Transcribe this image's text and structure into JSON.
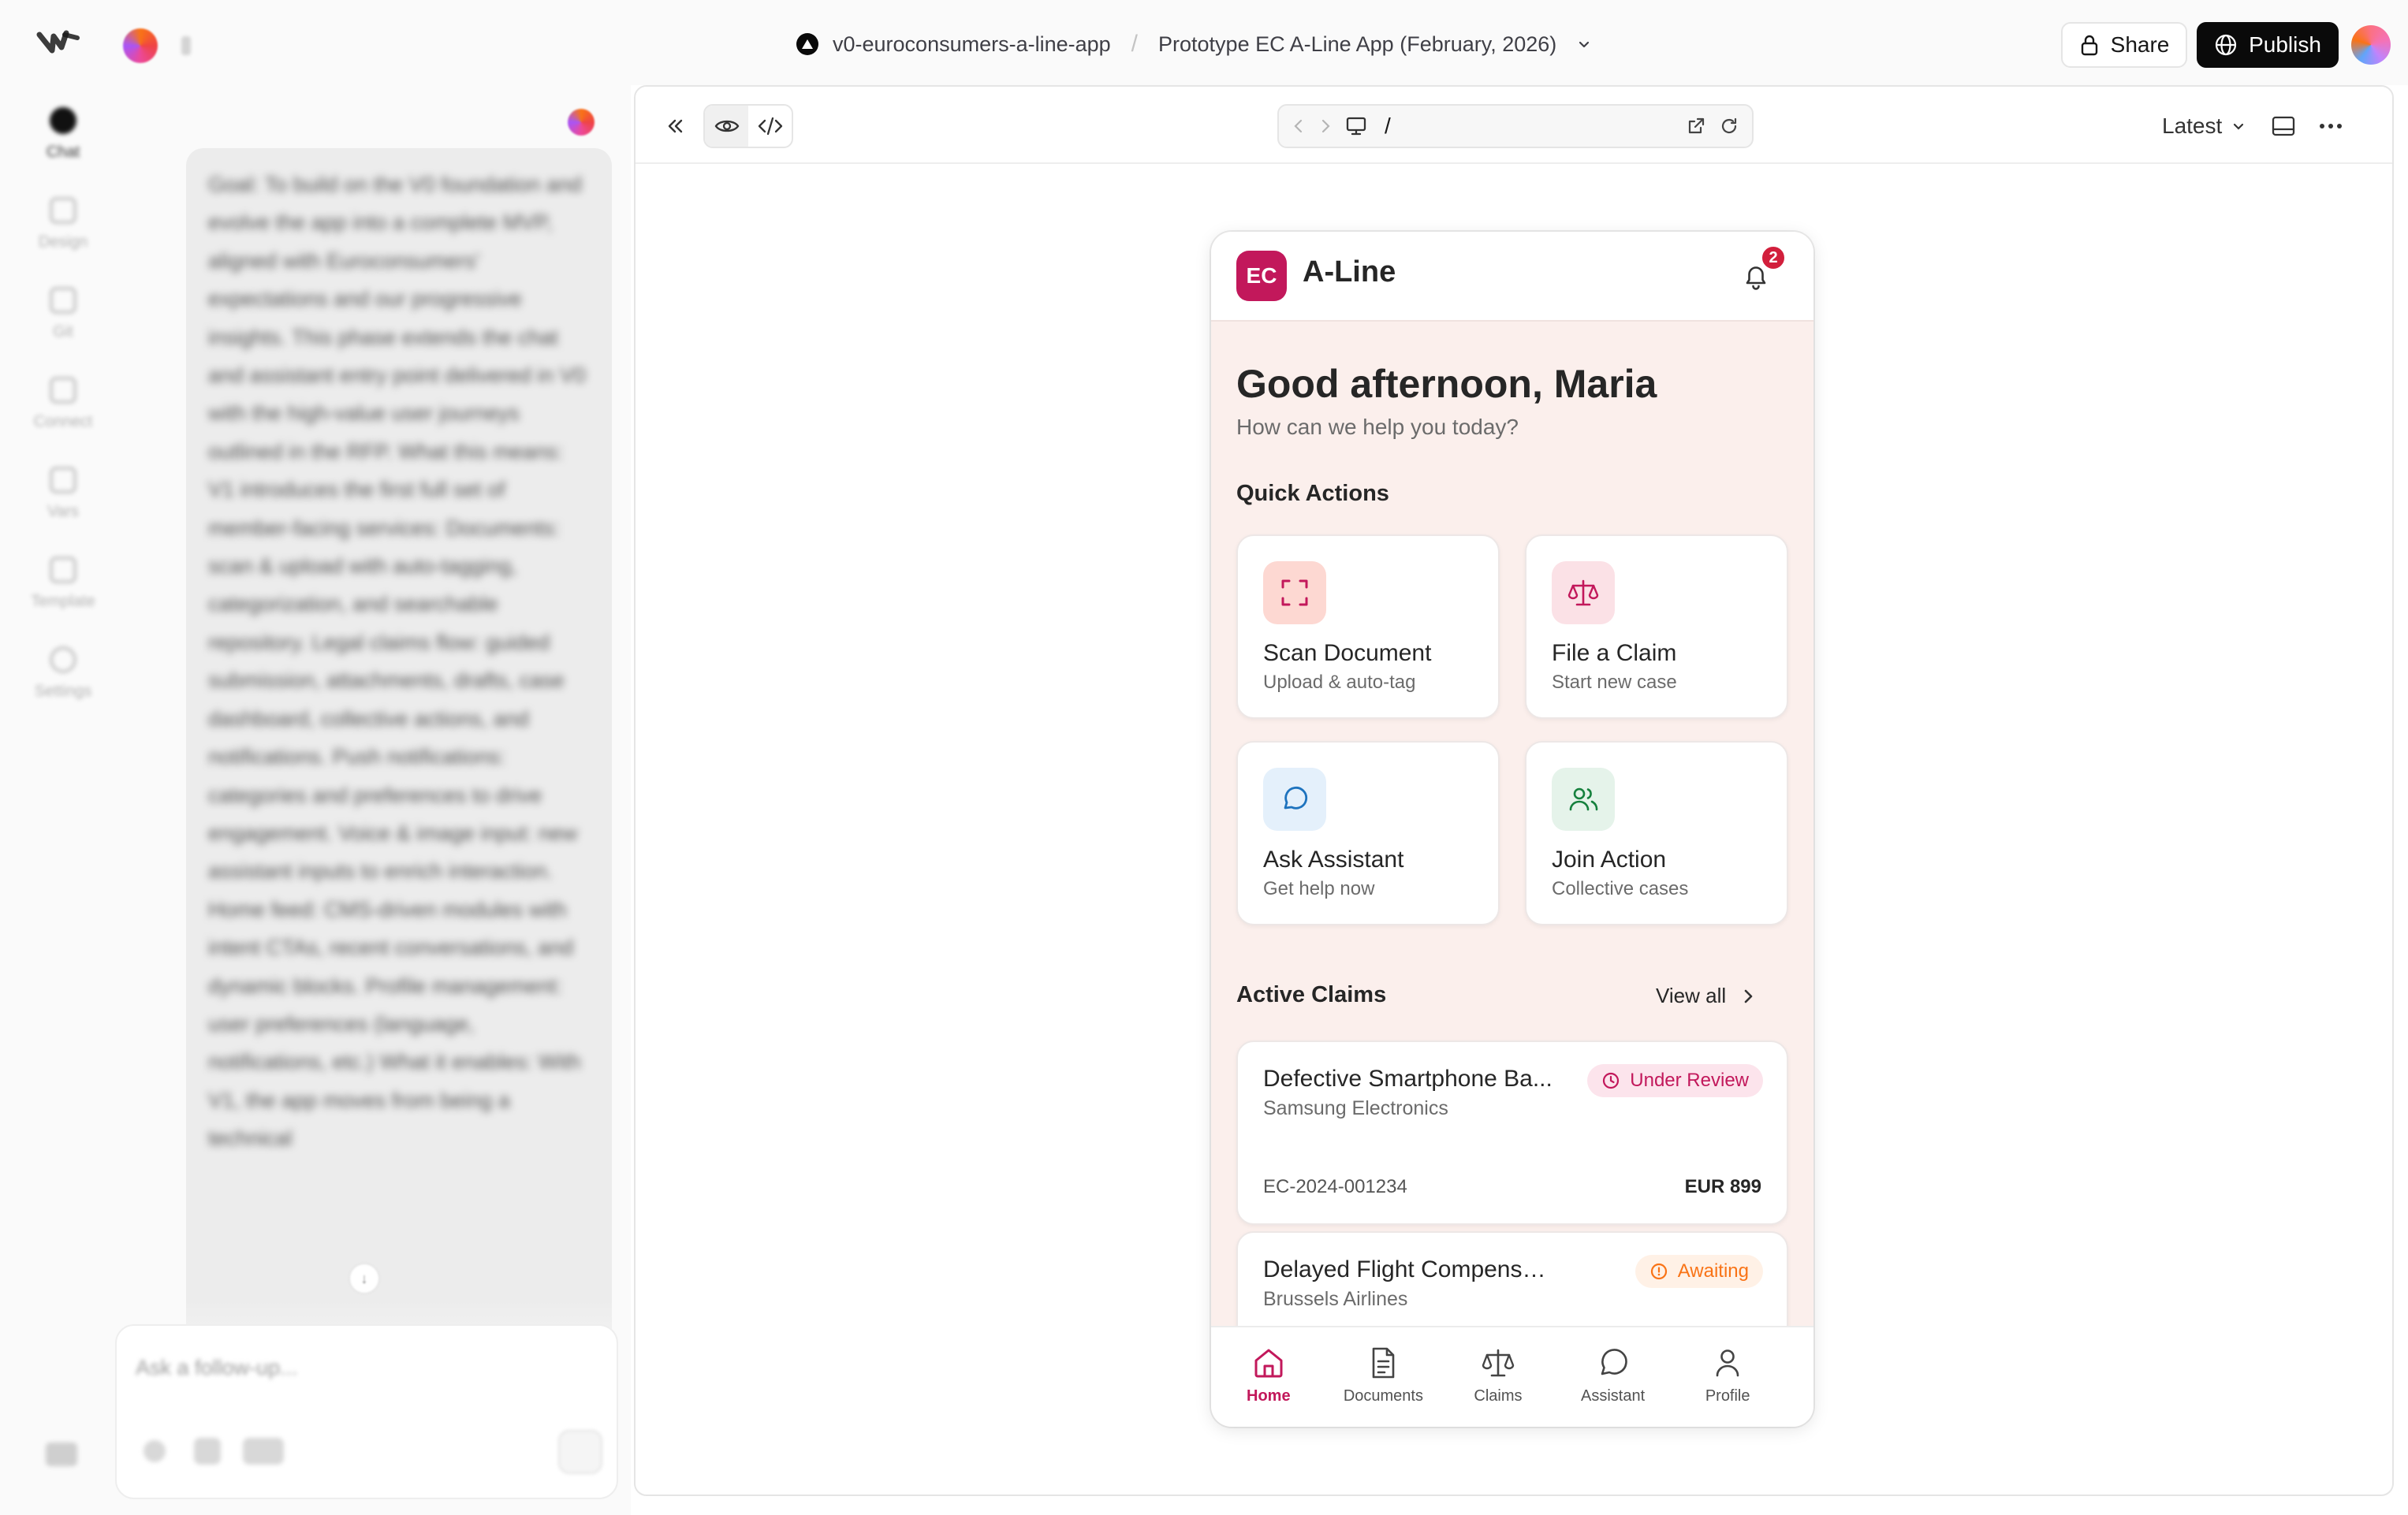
{
  "topbar": {
    "project_name": "v0-euroconsumers-a-line-app",
    "separator": "/",
    "version_name": "Prototype EC A-Line App (February, 2026)",
    "share_label": "Share",
    "publish_label": "Publish"
  },
  "rail": {
    "items": [
      {
        "label": "Chat",
        "icon": "chat-icon",
        "active": true
      },
      {
        "label": "Design",
        "icon": "design-icon"
      },
      {
        "label": "Git",
        "icon": "git-icon"
      },
      {
        "label": "Connect",
        "icon": "connect-icon"
      },
      {
        "label": "Vars",
        "icon": "vars-icon"
      },
      {
        "label": "Template",
        "icon": "template-icon"
      },
      {
        "label": "Settings",
        "icon": "settings-icon"
      }
    ]
  },
  "chat": {
    "message": "Goal: To build on the V0 foundation and evolve the app into a complete MVP, aligned with Euroconsumers' expectations and our progressive insights. This phase extends the chat and assistant entry point delivered in V0 with the high-value user journeys outlined in the RFP. What this means: V1 introduces the first full set of member-facing services: Documents: scan & upload with auto-tagging, categorization, and searchable repository. Legal claims flow: guided submission, attachments, drafts, case dashboard, collective actions, and notifications. Push notifications: categories and preferences to drive engagement. Voice & image input: new assistant inputs to enrich interaction. Home feed: CMS-driven modules with intent CTAs, recent conversations, and dynamic blocks. Profile management: user preferences (language, notifications, etc.) What it enables: With V1, the app moves from being a technical",
    "composer_placeholder": "Ask a follow-up..."
  },
  "preview": {
    "url_path": "/",
    "version_select": "Latest"
  },
  "app": {
    "logo_text": "EC",
    "app_name": "A-Line",
    "notification_count": "2",
    "greeting": "Good afternoon, Maria",
    "greeting_sub": "How can we help you today?",
    "quick_actions_title": "Quick Actions",
    "quick_actions": [
      {
        "title": "Scan Document",
        "subtitle": "Upload & auto-tag",
        "icon": "scan-icon"
      },
      {
        "title": "File a Claim",
        "subtitle": "Start new case",
        "icon": "scale-icon"
      },
      {
        "title": "Ask Assistant",
        "subtitle": "Get help now",
        "icon": "chat-bubble-icon"
      },
      {
        "title": "Join Action",
        "subtitle": "Collective cases",
        "icon": "users-icon"
      }
    ],
    "active_claims_title": "Active Claims",
    "view_all_label": "View all",
    "claims": [
      {
        "title": "Defective Smartphone Ba...",
        "company": "Samsung Electronics",
        "status": "Under Review",
        "id": "EC-2024-001234",
        "amount": "EUR 899"
      },
      {
        "title": "Delayed Flight Compensation",
        "company": "Brussels Airlines",
        "status": "Awaiting"
      }
    ],
    "tabs": [
      {
        "label": "Home",
        "icon": "home-icon",
        "active": true
      },
      {
        "label": "Documents",
        "icon": "document-icon"
      },
      {
        "label": "Claims",
        "icon": "scale-icon"
      },
      {
        "label": "Assistant",
        "icon": "chat-bubble-icon"
      },
      {
        "label": "Profile",
        "icon": "user-icon"
      }
    ]
  },
  "colors": {
    "brand": "#c2185b",
    "app_background": "#fbefec",
    "under_review": "#c2185b",
    "awaiting": "#f97316",
    "publish_bg": "#0a0a0a"
  }
}
